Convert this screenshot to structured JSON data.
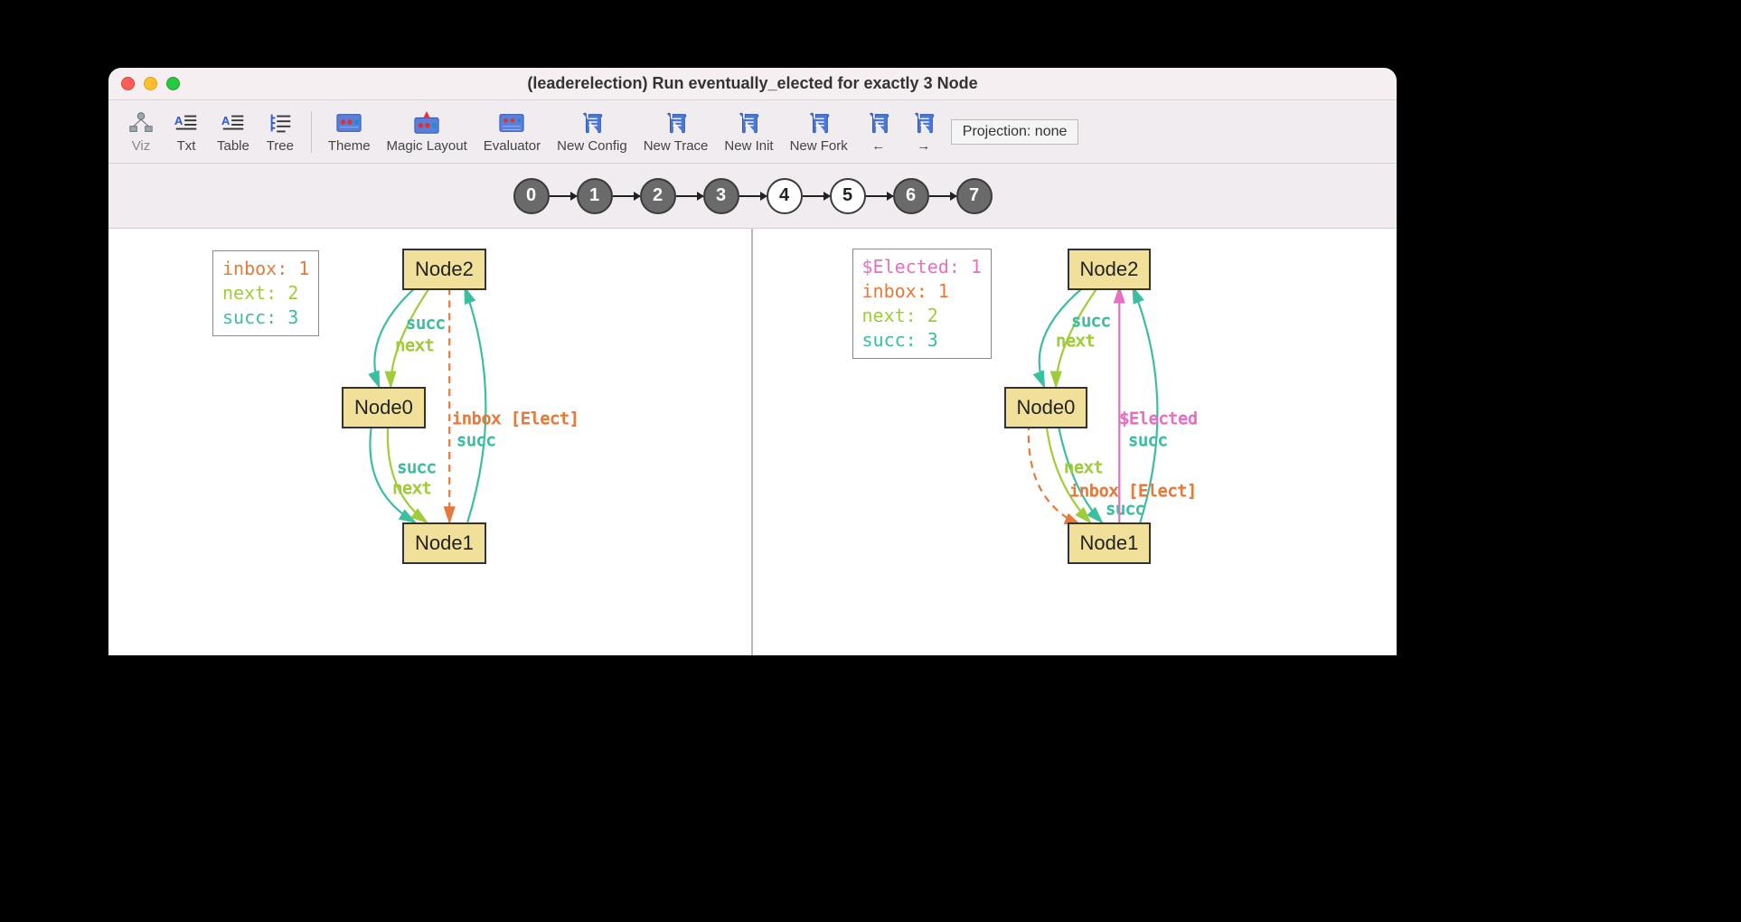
{
  "window": {
    "title": "(leaderelection) Run eventually_elected for exactly 3 Node"
  },
  "toolbar": [
    {
      "id": "viz",
      "label": "Viz",
      "active": true
    },
    {
      "id": "txt",
      "label": "Txt"
    },
    {
      "id": "table",
      "label": "Table"
    },
    {
      "id": "tree",
      "label": "Tree"
    },
    {
      "sep": true
    },
    {
      "id": "theme",
      "label": "Theme"
    },
    {
      "id": "magic",
      "label": "Magic Layout"
    },
    {
      "id": "eval",
      "label": "Evaluator"
    },
    {
      "id": "newconfig",
      "label": "New Config"
    },
    {
      "id": "newtrace",
      "label": "New Trace"
    },
    {
      "id": "newinit",
      "label": "New Init"
    },
    {
      "id": "newfork",
      "label": "New Fork"
    },
    {
      "id": "prev",
      "label": "←"
    },
    {
      "id": "next",
      "label": "→"
    }
  ],
  "projection_label": "Projection: none",
  "trace": {
    "states": [
      {
        "n": 0,
        "selected": true
      },
      {
        "n": 1,
        "selected": true
      },
      {
        "n": 2,
        "selected": true
      },
      {
        "n": 3,
        "selected": true
      },
      {
        "n": 4,
        "selected": false
      },
      {
        "n": 5,
        "selected": false
      },
      {
        "n": 6,
        "selected": true
      },
      {
        "n": 7,
        "selected": true,
        "loop": true
      }
    ]
  },
  "legend_left": {
    "inbox": "inbox: 1",
    "next": "next: 2",
    "succ": "succ: 3"
  },
  "legend_right": {
    "elected": "$Elected: 1",
    "inbox": "inbox: 1",
    "next": "next: 2",
    "succ": "succ: 3"
  },
  "nodes": {
    "n0": "Node0",
    "n1": "Node1",
    "n2": "Node2"
  },
  "edge_labels": {
    "succ": "succ",
    "next": "next",
    "inbox_elect": "inbox [Elect]",
    "elected": "$Elected"
  },
  "colors": {
    "succ": "#3cbea0",
    "next": "#a0cc3a",
    "inbox": "#e67a3c",
    "elected": "#e670c2",
    "node_fill": "#f0e09a"
  },
  "graphs": {
    "left": {
      "nodes": [
        "Node0",
        "Node1",
        "Node2"
      ],
      "edges": [
        {
          "from": "Node2",
          "to": "Node0",
          "kind": "succ"
        },
        {
          "from": "Node2",
          "to": "Node0",
          "kind": "next"
        },
        {
          "from": "Node0",
          "to": "Node1",
          "kind": "succ"
        },
        {
          "from": "Node0",
          "to": "Node1",
          "kind": "next"
        },
        {
          "from": "Node1",
          "to": "Node2",
          "kind": "succ"
        },
        {
          "from": "Node2",
          "to": "Node1",
          "kind": "inbox",
          "label": "inbox [Elect]"
        }
      ]
    },
    "right": {
      "nodes": [
        "Node0",
        "Node1",
        "Node2"
      ],
      "edges": [
        {
          "from": "Node2",
          "to": "Node0",
          "kind": "succ"
        },
        {
          "from": "Node2",
          "to": "Node0",
          "kind": "next"
        },
        {
          "from": "Node0",
          "to": "Node1",
          "kind": "succ"
        },
        {
          "from": "Node0",
          "to": "Node1",
          "kind": "next"
        },
        {
          "from": "Node1",
          "to": "Node2",
          "kind": "succ"
        },
        {
          "from": "Node0",
          "to": "Node1",
          "kind": "inbox",
          "label": "inbox [Elect]"
        },
        {
          "from": "Node1",
          "to": "Node2",
          "kind": "elected",
          "label": "$Elected"
        }
      ]
    }
  }
}
